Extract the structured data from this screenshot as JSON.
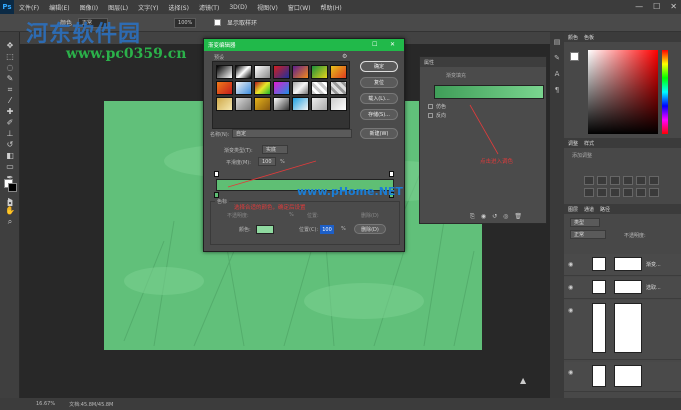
{
  "app": {
    "logo": "Ps"
  },
  "menubar": {
    "items": [
      "文件(F)",
      "编辑(E)",
      "图像(I)",
      "图层(L)",
      "文字(Y)",
      "选择(S)",
      "滤镜(T)",
      "3D(D)",
      "视图(V)",
      "窗口(W)",
      "帮助(H)"
    ]
  },
  "window": {
    "minimize": "—",
    "maximize": "☐",
    "close": "✕"
  },
  "optbar": {
    "mode_label": "颜色",
    "blend": "正常",
    "opacity": "100%",
    "checkbox_label": "显示取样环"
  },
  "watermark": {
    "text": "河东软件园",
    "url": "www.pc0359.cn"
  },
  "statusbar": {
    "zoom": "16.67%",
    "doc": "文档:45.8M/45.8M"
  },
  "gradient_editor": {
    "title": "渐变编辑器",
    "presets_label": "预设",
    "ok": "确定",
    "reset": "复位",
    "load": "载入(L)...",
    "save": "存储(S)...",
    "name_label": "名称(N):",
    "name_value": "自定",
    "new_button": "新建(W)",
    "type_label": "渐变类型(T):",
    "type_value": "实底",
    "smooth_label": "平滑度(M):",
    "smooth_value": "100",
    "smooth_unit": "%",
    "stops_label": "色标",
    "opacity_label": "不透明度:",
    "opacity_pct": "%",
    "position_label_1": "位置:",
    "delete_1": "删除(D)",
    "color_label": "颜色:",
    "position_label_2": "位置(C):",
    "position_value": "100",
    "position_unit": "%",
    "delete_2": "删除(D)",
    "stop_color": "#8fd9a0"
  },
  "annotations": {
    "choose_color": "选择合适的颜色，确定后设置",
    "click_gradient": "点击进入调色",
    "phome": "www.pHome.NET"
  },
  "properties_panel": {
    "title": "属性",
    "subtitle": "渐变填充",
    "opt1": "仿色",
    "opt2": "反向"
  },
  "panels": {
    "color_tabs": [
      "颜色",
      "色板"
    ],
    "adjust_tabs": [
      "调整",
      "样式"
    ],
    "adjust_label": "添加调整",
    "layers_tabs": [
      "图层",
      "通道",
      "路径"
    ],
    "layers_kind": "类型",
    "layers_blend": "正常",
    "layers_opacity": "不透明度:",
    "layer_names": [
      "渐变...",
      "选取...",
      "",
      ""
    ]
  },
  "colors": {
    "title_green": "#21b94a",
    "gradient_green": "#5fbf74",
    "annotation_red": "#e23b3b"
  }
}
